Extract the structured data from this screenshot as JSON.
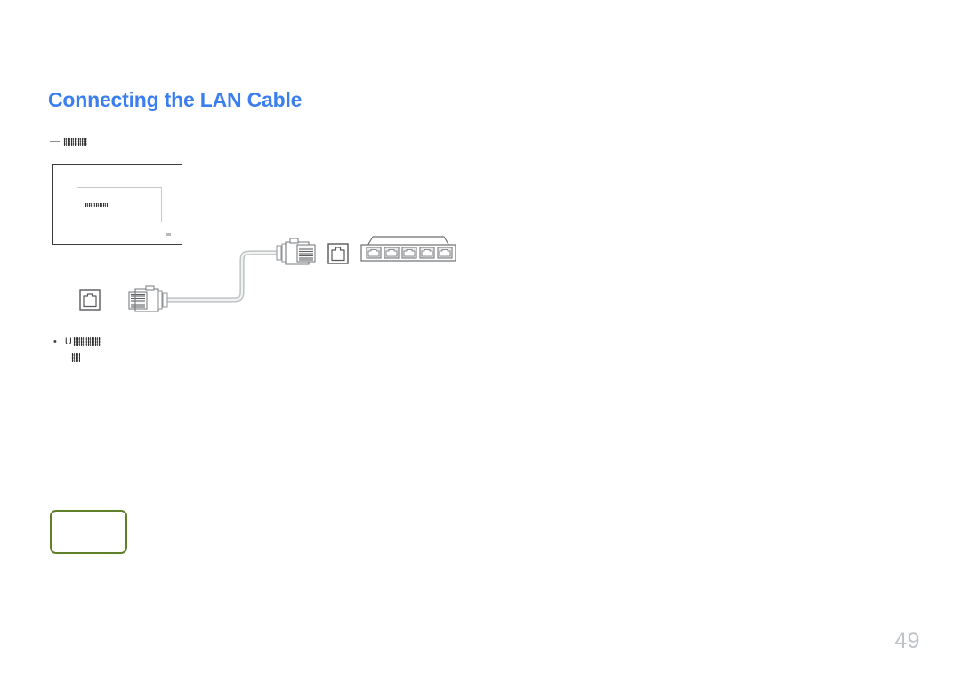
{
  "document": {
    "page_number": "49",
    "title": "Connecting the LAN Cable",
    "title_color": "#3b7eee"
  },
  "subtitle": {
    "dash_icon": "em-dash-icon",
    "redacted_label": "redacted-text"
  },
  "diagram": {
    "name": "lan-cable-connection-diagram",
    "monitor": {
      "label": "display-monitor",
      "screen_logo": "samsung-logo",
      "corner_mark": "monitor-corner-mark"
    },
    "cable": {
      "label": "lan-cable",
      "color": "#c9cccd",
      "plug_upper": "rj45-plug-upper",
      "plug_lower": "rj45-plug-lower"
    },
    "ports": {
      "upper_port": "rj45-port-upper",
      "lower_port": "rj45-port-lower"
    },
    "router": {
      "label": "network-switch",
      "port_count": 5,
      "ports": [
        "port-1",
        "port-2",
        "port-3",
        "port-4",
        "port-5"
      ]
    }
  },
  "note": {
    "bullet": "•",
    "lead_text": "U",
    "redacted_inline": "redacted-text",
    "redacted_second_line": "redacted-text"
  },
  "callout": {
    "label": "green-callout-box",
    "border_color": "#5e8029",
    "content": ""
  }
}
